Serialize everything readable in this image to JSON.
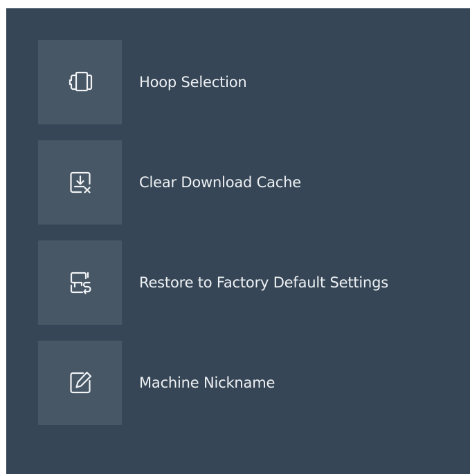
{
  "colors": {
    "panel_background": "#364656",
    "tile_background": "#475766",
    "icon_stroke": "#f2f4f6",
    "label_text": "#eef1f4"
  },
  "menu": {
    "items": [
      {
        "label": "Hoop Selection",
        "icon": "hoop-icon"
      },
      {
        "label": "Clear Download Cache",
        "icon": "clear-download-cache-icon"
      },
      {
        "label": "Restore to Factory Default Settings",
        "icon": "factory-reset-icon"
      },
      {
        "label": "Machine Nickname",
        "icon": "edit-pencil-icon"
      }
    ]
  }
}
